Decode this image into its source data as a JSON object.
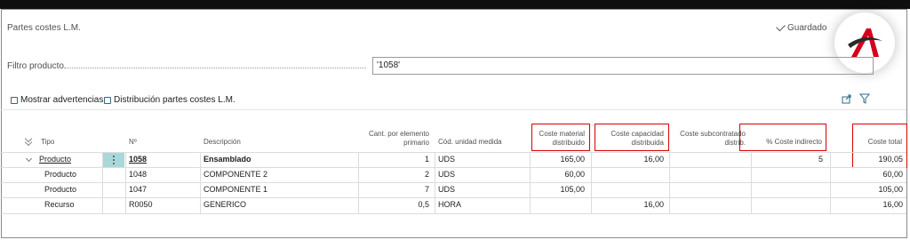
{
  "page": {
    "title": "Partes costes L.M.",
    "saved_status": "Guardado"
  },
  "filter": {
    "label": "Filtro producto",
    "value": "'1058'"
  },
  "toolbar": {
    "show_warnings": "Mostrar advertencias",
    "distribution": "Distribución partes costes L.M."
  },
  "table": {
    "headers": {
      "tipo": "Tipo",
      "no": "Nº",
      "descripcion": "Descripción",
      "cant_line1": "Cant. por elemento",
      "cant_line2": "primario",
      "unidad": "Cód. unidad medida",
      "coste_material_line1": "Coste material",
      "coste_material_line2": "distribuido",
      "coste_capacidad_line1": "Coste capacidad",
      "coste_capacidad_line2": "distribuida",
      "coste_subcontratado_line1": "Coste subcontratado",
      "coste_subcontratado_line2": "distrib.",
      "pct_indirecto": "% Coste indirecto",
      "coste_total": "Coste total"
    },
    "rows": [
      {
        "tipo": "Producto",
        "no": "1058",
        "descripcion": "Ensamblado",
        "cant": "1",
        "unidad": "UDS",
        "coste_material": "165,00",
        "coste_capacidad": "16,00",
        "coste_subcontratado": "",
        "pct_indirecto": "5",
        "coste_total": "190,05"
      },
      {
        "tipo": "Producto",
        "no": "1048",
        "descripcion": "COMPONENTE 2",
        "cant": "2",
        "unidad": "UDS",
        "coste_material": "60,00",
        "coste_capacidad": "",
        "coste_subcontratado": "",
        "pct_indirecto": "",
        "coste_total": "60,00"
      },
      {
        "tipo": "Producto",
        "no": "1047",
        "descripcion": "COMPONENTE 1",
        "cant": "7",
        "unidad": "UDS",
        "coste_material": "105,00",
        "coste_capacidad": "",
        "coste_subcontratado": "",
        "pct_indirecto": "",
        "coste_total": "105,00"
      },
      {
        "tipo": "Recurso",
        "no": "R0050",
        "descripcion": "GENERICO",
        "cant": "0,5",
        "unidad": "HORA",
        "coste_material": "",
        "coste_capacidad": "16,00",
        "coste_subcontratado": "",
        "pct_indirecto": "",
        "coste_total": "16,00"
      }
    ]
  },
  "colors": {
    "highlight_box": "#d50000",
    "selected_cell": "#a9d8d8",
    "logo_red": "#d5001c"
  },
  "icons": {
    "logo": "brand-a-logo",
    "share": "share-icon",
    "filter": "filter-icon"
  }
}
